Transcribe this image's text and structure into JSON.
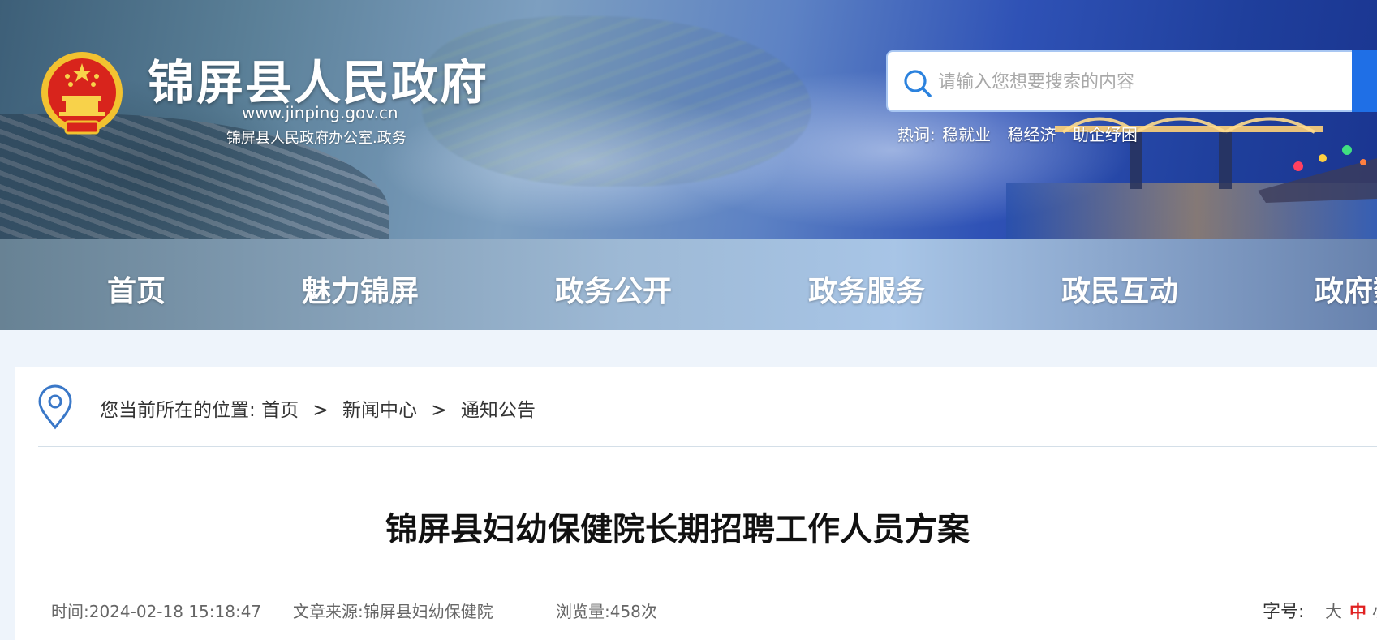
{
  "header": {
    "site_title": "锦屏县人民政府",
    "site_url": "www.jinping.gov.cn",
    "site_owner": "锦屏县人民政府办公室.政务",
    "search_placeholder": "请输入您想要搜索的内容",
    "hot_label": "热词:",
    "hot_words": [
      "稳就业",
      "稳经济",
      "助企纾困"
    ]
  },
  "nav": {
    "items": [
      "首页",
      "魅力锦屏",
      "政务公开",
      "政务服务",
      "政民互动",
      "政府数"
    ]
  },
  "breadcrumb": {
    "prefix": "您当前所在的位置:",
    "items": [
      "首页",
      "新闻中心",
      "通知公告"
    ],
    "separator": ">"
  },
  "article": {
    "title": "锦屏县妇幼保健院长期招聘工作人员方案",
    "time": "时间:2024-02-18 15:18:47",
    "source": "文章来源:锦屏县妇幼保健院",
    "views": "浏览量:458次",
    "font_size_label": "字号:",
    "font_sizes": [
      "大",
      "中",
      "小"
    ],
    "font_size_selected": "中"
  },
  "colors": {
    "accent": "#1f6fe6",
    "font_size_active": "#e02020"
  }
}
